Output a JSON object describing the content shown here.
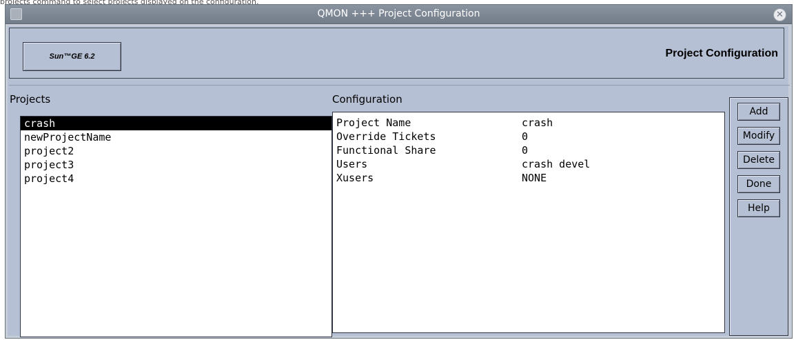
{
  "caption": "projects command to select projects displayed on the configuration.",
  "window": {
    "title": "QMON +++ Project Configuration"
  },
  "header": {
    "logo": "Sun™GE 6.2",
    "title": "Project Configuration"
  },
  "projects": {
    "label": "Projects",
    "items": [
      "crash",
      "newProjectName",
      "project2",
      "project3",
      "project4"
    ],
    "selected": "crash"
  },
  "configuration": {
    "label": "Configuration",
    "rows": [
      {
        "key": "Project Name",
        "value": "crash"
      },
      {
        "key": "Override Tickets",
        "value": "0"
      },
      {
        "key": "Functional Share",
        "value": "0"
      },
      {
        "key": "Users",
        "value": "crash devel"
      },
      {
        "key": "Xusers",
        "value": "NONE"
      }
    ]
  },
  "buttons": {
    "add": "Add",
    "modify": "Modify",
    "delete": "Delete",
    "done": "Done",
    "help": "Help"
  },
  "colors": {
    "background": "#b6c0d4",
    "titlebar": "#7f8894",
    "selection": "#000000"
  }
}
